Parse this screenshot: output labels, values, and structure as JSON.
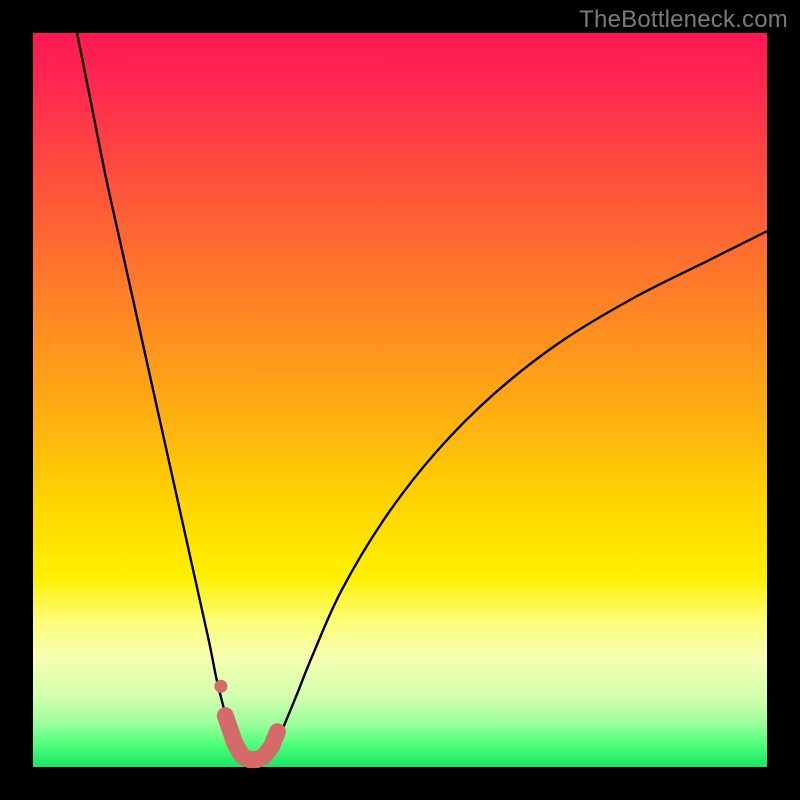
{
  "watermark": "TheBottleneck.com",
  "chart_data": {
    "type": "line",
    "title": "",
    "xlabel": "",
    "ylabel": "",
    "xlim": [
      0,
      100
    ],
    "ylim": [
      0,
      100
    ],
    "series": [
      {
        "name": "curve",
        "x": [
          6,
          8,
          10,
          12,
          14,
          16,
          18,
          20,
          22,
          24,
          25,
          26,
          27,
          28,
          29,
          30,
          31,
          32,
          33,
          34,
          36,
          38,
          42,
          48,
          55,
          63,
          72,
          82,
          92,
          100
        ],
        "y": [
          100,
          90,
          80,
          71,
          62,
          53,
          44,
          35,
          26,
          17,
          12,
          8,
          4.5,
          2.3,
          1.2,
          1.0,
          1.1,
          1.8,
          3.2,
          5.2,
          10,
          15,
          24,
          34,
          43,
          51,
          58,
          64,
          69,
          73
        ]
      }
    ],
    "markers": {
      "name": "red-highlight",
      "color": "#d46a6a",
      "x": [
        26.2,
        27.5,
        28.5,
        29.5,
        30.5,
        31.5,
        32.5,
        33.3
      ],
      "y": [
        7.0,
        3.2,
        1.5,
        1.0,
        1.0,
        1.5,
        2.8,
        4.8
      ]
    }
  },
  "colors": {
    "curve_stroke": "#000000",
    "marker_stroke": "#d46a6a",
    "frame": "#000000"
  }
}
